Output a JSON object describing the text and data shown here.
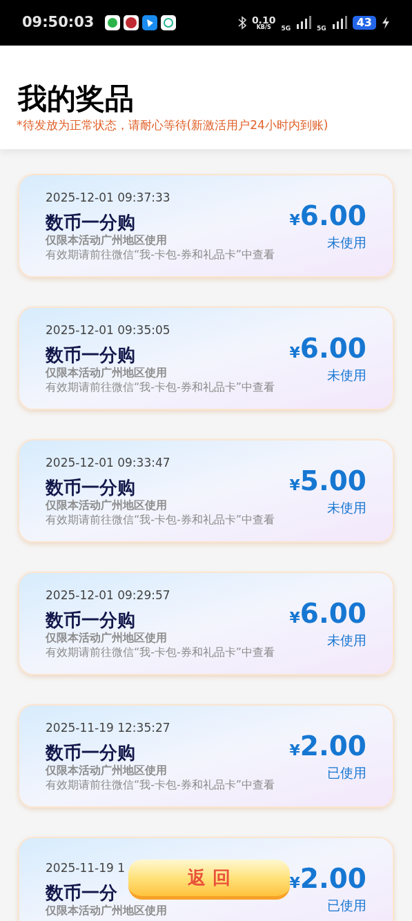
{
  "status_bar": {
    "time": "09:50:03",
    "net_speed": "0.10",
    "net_unit": "KB/S",
    "sim_1": "5G",
    "sim_2": "5G",
    "battery": "43"
  },
  "header": {
    "title": "我的奖品",
    "notice": "*待发放为正常状态，请耐心等待(新激活用户24小时内到账)"
  },
  "prizes": [
    {
      "time": "2025-12-01 09:37:33",
      "name": "数币一分购",
      "area": "仅限本活动广州地区使用",
      "hint": "有效期请前往微信“我-卡包-券和礼品卡”中查看",
      "currency": "¥",
      "amount": "6.00",
      "status": "未使用"
    },
    {
      "time": "2025-12-01 09:35:05",
      "name": "数币一分购",
      "area": "仅限本活动广州地区使用",
      "hint": "有效期请前往微信“我-卡包-券和礼品卡”中查看",
      "currency": "¥",
      "amount": "6.00",
      "status": "未使用"
    },
    {
      "time": "2025-12-01 09:33:47",
      "name": "数币一分购",
      "area": "仅限本活动广州地区使用",
      "hint": "有效期请前往微信“我-卡包-券和礼品卡”中查看",
      "currency": "¥",
      "amount": "5.00",
      "status": "未使用"
    },
    {
      "time": "2025-12-01 09:29:57",
      "name": "数币一分购",
      "area": "仅限本活动广州地区使用",
      "hint": "有效期请前往微信“我-卡包-券和礼品卡”中查看",
      "currency": "¥",
      "amount": "6.00",
      "status": "未使用"
    },
    {
      "time": "2025-11-19 12:35:27",
      "name": "数币一分购",
      "area": "仅限本活动广州地区使用",
      "hint": "有效期请前往微信“我-卡包-券和礼品卡”中查看",
      "currency": "¥",
      "amount": "2.00",
      "status": "已使用"
    },
    {
      "time": "2025-11-19 1",
      "name": "数币一分",
      "area": "仅限本活动广州地区使用",
      "currency": "¥",
      "amount": "2.00",
      "status": "已使用"
    }
  ],
  "back_button": {
    "label": "返 回"
  }
}
